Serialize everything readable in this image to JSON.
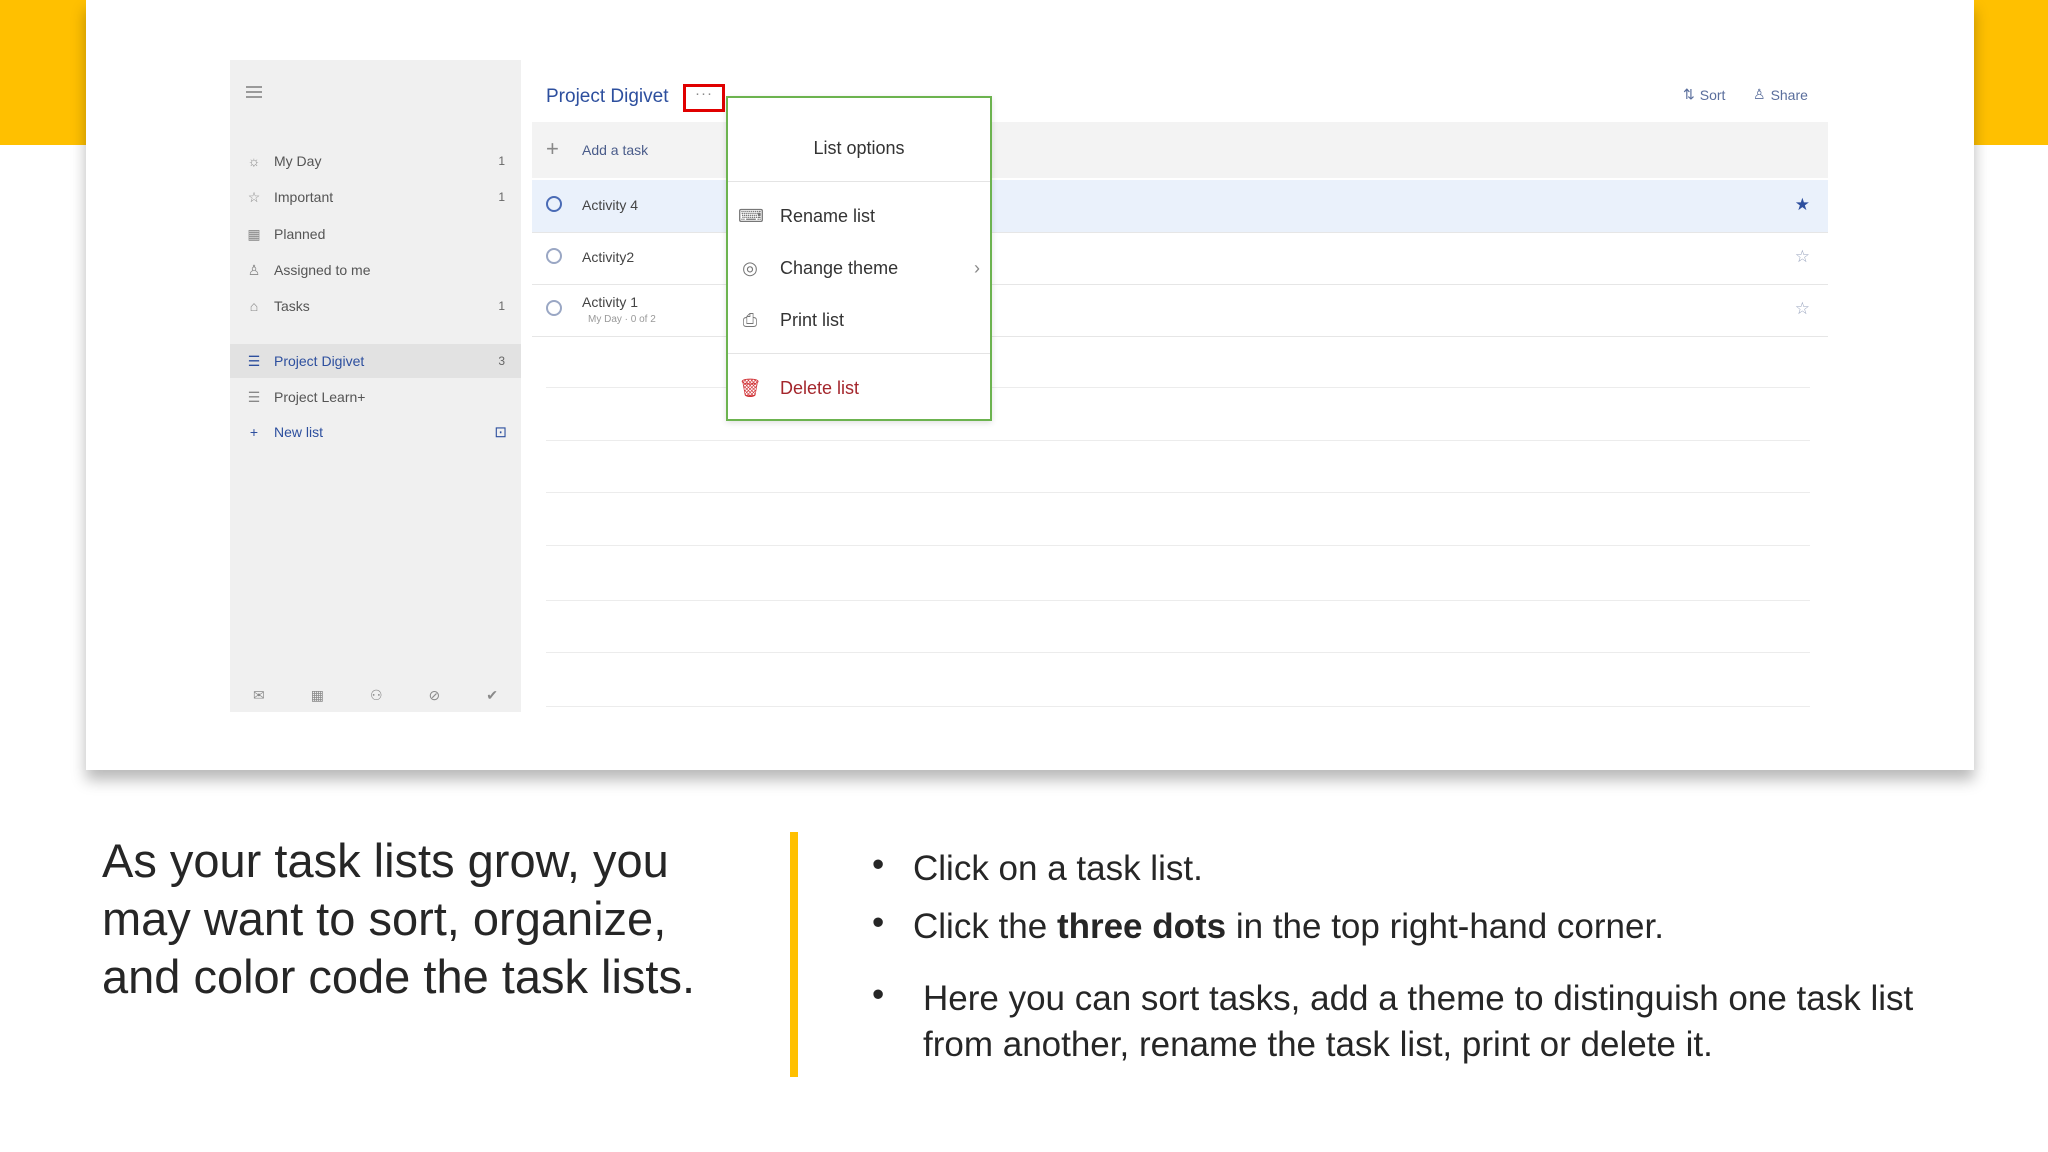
{
  "sidebar": {
    "items": [
      {
        "label": "My Day",
        "icon": "sun-icon",
        "count": "1"
      },
      {
        "label": "Important",
        "icon": "star-icon",
        "count": "1"
      },
      {
        "label": "Planned",
        "icon": "calendar-icon",
        "count": ""
      },
      {
        "label": "Assigned to me",
        "icon": "person-icon",
        "count": ""
      },
      {
        "label": "Tasks",
        "icon": "home-icon",
        "count": "1"
      }
    ],
    "lists": [
      {
        "label": "Project Digivet",
        "count": "3"
      },
      {
        "label": "Project Learn+",
        "count": ""
      }
    ],
    "new_list": "New list"
  },
  "main": {
    "title": "Project Digivet",
    "more_glyph": "···",
    "sort_label": "Sort",
    "share_label": "Share",
    "add_task": "Add a task",
    "tasks": [
      {
        "label": "Activity 4",
        "sub": "",
        "important": true
      },
      {
        "label": "Activity2",
        "sub": "",
        "important": false
      },
      {
        "label": "Activity 1",
        "sub": "My Day · 0 of 2",
        "important": false
      }
    ]
  },
  "menu": {
    "title": "List options",
    "rename": "Rename list",
    "theme": "Change theme",
    "print": "Print list",
    "delete": "Delete list"
  },
  "slide": {
    "intro": "As your task lists grow, you may want to sort, organize, and color code the task lists.",
    "bullet1": "Click on a task list.",
    "bullet2_pre": "Click the ",
    "bullet2_bold": "three dots",
    "bullet2_post": " in the top right-hand corner.",
    "bullet3": "Here you can sort tasks, add a theme to distinguish one task list from another, rename the task list, print or delete it."
  },
  "colors": {
    "accent": "#FFC000",
    "brand": "#2d4f9e",
    "highlight": "#e00000",
    "menu_border": "#6cb34f"
  }
}
